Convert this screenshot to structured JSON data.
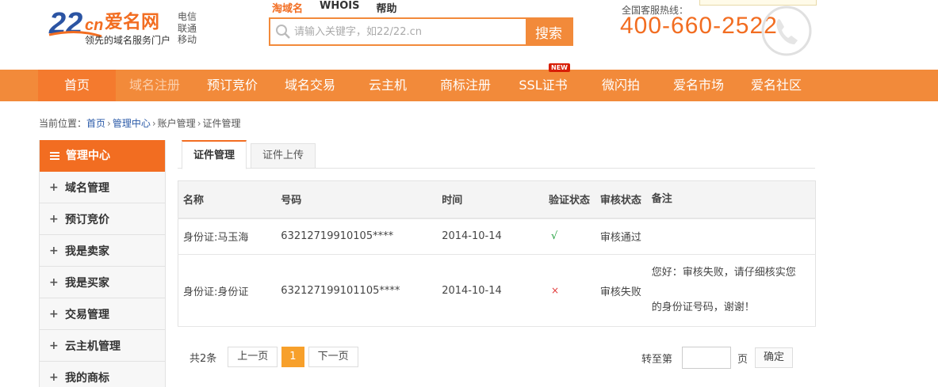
{
  "header": {
    "logo_text": "22cn爱名网",
    "logo_slogan": "领先的域名服务门户",
    "carriers": [
      "电信",
      "联通",
      "移动"
    ],
    "search_tabs": [
      "淘域名",
      "WHOIS",
      "帮助"
    ],
    "search_placeholder": "请输入关键字，如22/22.cn",
    "search_button": "搜索",
    "hotline_label": "全国客服热线：",
    "hotline_number": "400-660-2522"
  },
  "nav": {
    "items": [
      "首页",
      "域名注册",
      "预订竞价",
      "域名交易",
      "云主机",
      "商标注册",
      "SSL证书",
      "微闪拍",
      "爱名市场",
      "爱名社区"
    ],
    "badge": "NEW"
  },
  "breadcrumb": {
    "label": "当前位置：",
    "items": [
      "首页",
      "管理中心",
      "账户管理",
      "证件管理"
    ]
  },
  "sidebar": {
    "title": "管理中心",
    "items": [
      "域名管理",
      "预订竞价",
      "我是卖家",
      "我是买家",
      "交易管理",
      "云主机管理",
      "我的商标"
    ]
  },
  "tabs": [
    "证件管理",
    "证件上传"
  ],
  "table": {
    "headers": [
      "名称",
      "号码",
      "时间",
      "验证状态",
      "审核状态",
      "备注"
    ],
    "rows": [
      {
        "name": "身份证:马玉海",
        "number": "63212719910105****",
        "time": "2014-10-14",
        "verify": "√",
        "audit": "审核通过",
        "remark": ""
      },
      {
        "name": "身份证:身份证",
        "number": "632127199101105****",
        "time": "2014-10-14",
        "verify": "×",
        "audit": "审核失败",
        "remark_lines": [
          "您好：审核失败，请仔细核实您",
          "的身份证号码，谢谢！"
        ]
      }
    ]
  },
  "pager": {
    "total": "共2条",
    "prev": "上一页",
    "current": "1",
    "next": "下一页",
    "jump_label": "转至第",
    "page_unit": "页",
    "confirm": "确定"
  },
  "colors": {
    "brand_orange": "#f28a3a",
    "accent": "#f26d21",
    "success": "#1e9e3a",
    "fail": "#e23b3b"
  }
}
